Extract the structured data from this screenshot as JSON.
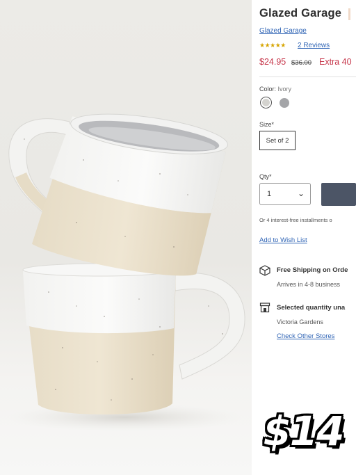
{
  "product": {
    "title": "Glazed Garage",
    "brand": "Glazed Garage",
    "stars": "★★★★★",
    "rating_value": 5,
    "reviews": "2 Reviews",
    "price": "$24.95",
    "original_price": "$36.00",
    "extra_discount": "Extra 40"
  },
  "options": {
    "color_label": "Color:",
    "color_value": "Ivory",
    "swatches": [
      {
        "name": "Ivory",
        "hex": "#d4d3cf",
        "selected": true
      },
      {
        "name": "Grey",
        "hex": "#a4a5a8",
        "selected": false
      }
    ],
    "size_label": "Size*",
    "size_value": "Set of 2",
    "qty_label": "Qty*",
    "qty_value": "1"
  },
  "purchase": {
    "installments": "Or 4 interest-free installments o",
    "wishlist": "Add to Wish List",
    "cart_button_color": "#4c5566"
  },
  "fulfillment": {
    "shipping_title": "Free Shipping on Orde",
    "shipping_sub": "Arrives in 4-8 business",
    "store_title": "Selected quantity una",
    "store_sub": "Victoria Gardens",
    "store_link": "Check Other Stores"
  },
  "promo": {
    "price_overlay": "$14"
  },
  "colors": {
    "link": "#2f64b5",
    "sale": "#c6364a",
    "stars": "#d6a400"
  }
}
